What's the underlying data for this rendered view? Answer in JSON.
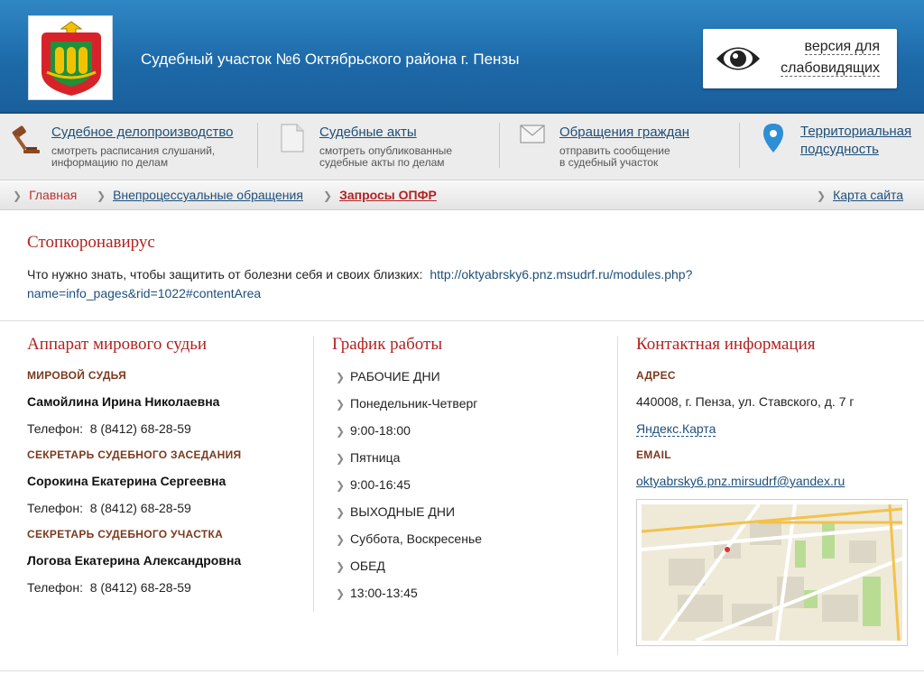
{
  "header": {
    "site_title": "Судебный участок №6 Октябрьского района г. Пензы",
    "vision_label_1": "версия для",
    "vision_label_2": "слабовидящих"
  },
  "nav": [
    {
      "title": "Судебное делопроизводство",
      "desc1": "смотреть расписания слушаний,",
      "desc2": "информацию по делам",
      "icon": "gavel-icon"
    },
    {
      "title": "Судебные акты",
      "desc1": "смотреть опубликованные",
      "desc2": "судебные акты по делам",
      "icon": "document-icon"
    },
    {
      "title": "Обращения граждан",
      "desc1": "отправить сообщение",
      "desc2": "в судебный участок",
      "icon": "envelope-icon"
    },
    {
      "title1": "Территориальная",
      "title2": "подсудность",
      "icon": "map-pin-icon"
    }
  ],
  "breadcrumbs": {
    "home": "Главная",
    "section": "Внепроцессуальные обращения",
    "current": "Запросы ОПФР",
    "sitemap": "Карта сайта"
  },
  "notice": {
    "title": "Стопкоронавирус",
    "text": "Что нужно знать, чтобы защитить от болезни себя и своих близких:",
    "link_line1": "http://oktyabrsky6.pnz.msudrf.ru/modules.php?",
    "link_line2": "name=info_pages&rid=1022#contentArea"
  },
  "staff": {
    "title": "Аппарат мирового судьи",
    "phone_label": "Телефон:",
    "people": [
      {
        "role": "МИРОВОЙ СУДЬЯ",
        "name": "Самойлина Ирина Николаевна",
        "phone": "8 (8412) 68-28-59"
      },
      {
        "role": "СЕКРЕТАРЬ СУДЕБНОГО ЗАСЕДАНИЯ",
        "name": "Сорокина Екатерина Сергеевна",
        "phone": "8 (8412) 68-28-59"
      },
      {
        "role": "СЕКРЕТАРЬ СУДЕБНОГО УЧАСТКА",
        "name": "Логова Екатерина Александровна",
        "phone": "8 (8412) 68-28-59"
      }
    ]
  },
  "schedule": {
    "title": "График работы",
    "items": [
      "РАБОЧИЕ ДНИ",
      "Понедельник-Четверг",
      "9:00-18:00",
      "Пятница",
      "9:00-16:45",
      "ВЫХОДНЫЕ ДНИ",
      "Суббота, Воскресенье",
      "ОБЕД",
      "13:00-13:45"
    ]
  },
  "contacts": {
    "title": "Контактная информация",
    "address_label": "АДРЕС",
    "address": "440008, г. Пенза, ул. Ставского, д. 7 г",
    "map_link": "Яндекс.Карта",
    "email_label": "EMAIL",
    "email": "oktyabrsky6.pnz.mirsudrf@yandex.ru"
  },
  "colors": {
    "header_blue": "#1d6aa9",
    "accent_red": "#b22222",
    "link_blue": "#1e4f7a"
  }
}
